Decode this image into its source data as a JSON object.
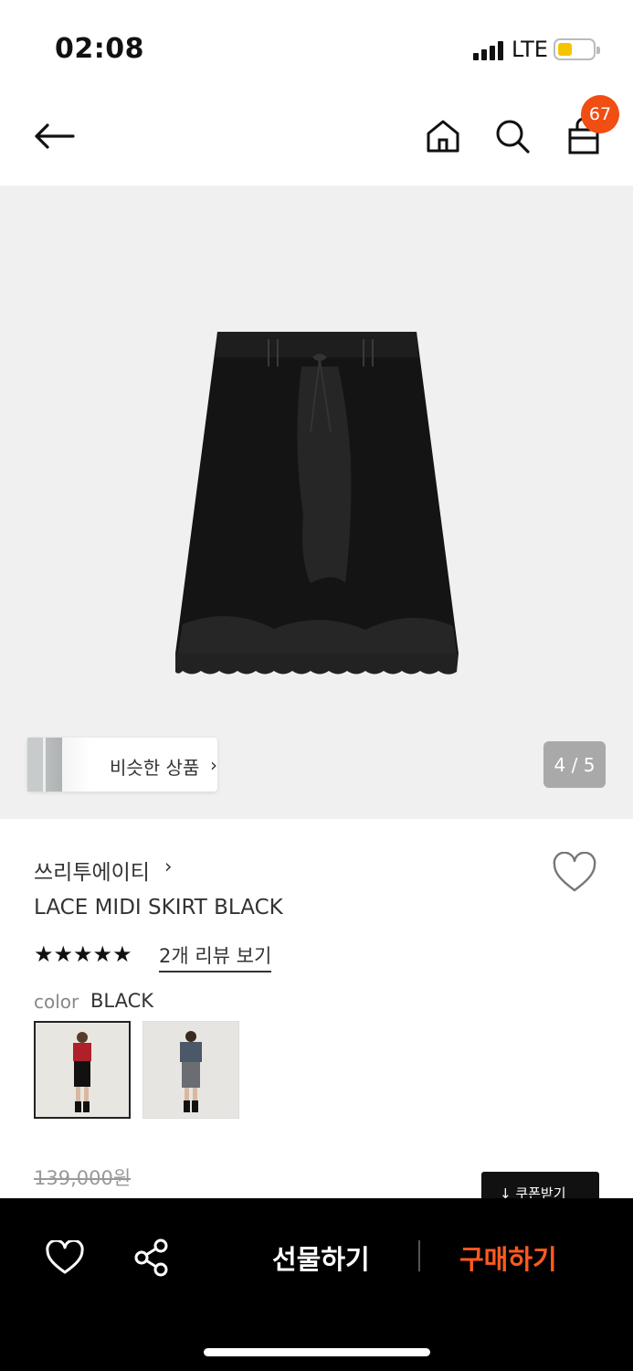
{
  "status_bar": {
    "time": "02:08",
    "network": "LTE",
    "battery_level": 0.3
  },
  "header": {
    "cart_count": "67"
  },
  "gallery": {
    "similar_label": "비슷한 상품",
    "page_indicator": "4 / 5"
  },
  "product": {
    "brand": "쓰리투에이티",
    "title": "LACE MIDI SKIRT BLACK",
    "rating_stars": "★★★★★",
    "rating": 5,
    "review_link": "2개 리뷰 보기",
    "color_label": "color",
    "color_value": "BLACK",
    "original_price": "139,000원",
    "coupon_button": "↓ 쿠폰받기"
  },
  "bottom_bar": {
    "gift_label": "선물하기",
    "buy_label": "구매하기"
  },
  "colors": {
    "accent": "#ff5a1f",
    "badge": "#f04e12"
  }
}
